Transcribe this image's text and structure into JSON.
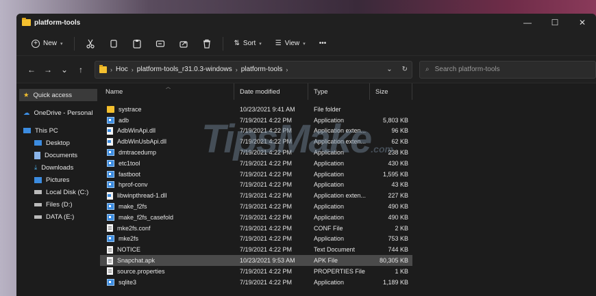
{
  "window": {
    "title": "platform-tools"
  },
  "window_controls": {
    "minimize": "—",
    "maximize": "☐",
    "close": "✕"
  },
  "toolbar": {
    "new_label": "New",
    "sort_label": "Sort",
    "view_label": "View",
    "more_label": "•••"
  },
  "address": {
    "crumbs": [
      "Hoc",
      "platform-tools_r31.0.3-windows",
      "platform-tools"
    ]
  },
  "search": {
    "placeholder": "Search platform-tools"
  },
  "sidebar": {
    "items": [
      {
        "label": "Quick access",
        "icon": "star-icon"
      },
      {
        "label": "OneDrive - Personal",
        "icon": "cloud-icon"
      },
      {
        "label": "This PC",
        "icon": "monitor-icon"
      },
      {
        "label": "Desktop",
        "icon": "desktop-icon"
      },
      {
        "label": "Documents",
        "icon": "documents-icon"
      },
      {
        "label": "Downloads",
        "icon": "download-icon"
      },
      {
        "label": "Pictures",
        "icon": "pictures-icon"
      },
      {
        "label": "Local Disk (C:)",
        "icon": "drive-icon"
      },
      {
        "label": "Files (D:)",
        "icon": "drive-icon"
      },
      {
        "label": "DATA (E:)",
        "icon": "drive-icon"
      }
    ]
  },
  "columns": {
    "name": "Name",
    "date": "Date modified",
    "type": "Type",
    "size": "Size"
  },
  "files": [
    {
      "name": "systrace",
      "date": "10/23/2021 9:41 AM",
      "type": "File folder",
      "size": "",
      "icon": "folder"
    },
    {
      "name": "adb",
      "date": "7/19/2021 4:22 PM",
      "type": "Application",
      "size": "5,803 KB",
      "icon": "app"
    },
    {
      "name": "AdbWinApi.dll",
      "date": "7/19/2021 4:22 PM",
      "type": "Application exten...",
      "size": "96 KB",
      "icon": "dll"
    },
    {
      "name": "AdbWinUsbApi.dll",
      "date": "7/19/2021 4:22 PM",
      "type": "Application exten...",
      "size": "62 KB",
      "icon": "dll"
    },
    {
      "name": "dmtracedump",
      "date": "7/19/2021 4:22 PM",
      "type": "Application",
      "size": "238 KB",
      "icon": "app"
    },
    {
      "name": "etc1tool",
      "date": "7/19/2021 4:22 PM",
      "type": "Application",
      "size": "430 KB",
      "icon": "app"
    },
    {
      "name": "fastboot",
      "date": "7/19/2021 4:22 PM",
      "type": "Application",
      "size": "1,595 KB",
      "icon": "app"
    },
    {
      "name": "hprof-conv",
      "date": "7/19/2021 4:22 PM",
      "type": "Application",
      "size": "43 KB",
      "icon": "app"
    },
    {
      "name": "libwinpthread-1.dll",
      "date": "7/19/2021 4:22 PM",
      "type": "Application exten...",
      "size": "227 KB",
      "icon": "dll"
    },
    {
      "name": "make_f2fs",
      "date": "7/19/2021 4:22 PM",
      "type": "Application",
      "size": "490 KB",
      "icon": "app"
    },
    {
      "name": "make_f2fs_casefold",
      "date": "7/19/2021 4:22 PM",
      "type": "Application",
      "size": "490 KB",
      "icon": "app"
    },
    {
      "name": "mke2fs.conf",
      "date": "7/19/2021 4:22 PM",
      "type": "CONF File",
      "size": "2 KB",
      "icon": "doc"
    },
    {
      "name": "mke2fs",
      "date": "7/19/2021 4:22 PM",
      "type": "Application",
      "size": "753 KB",
      "icon": "app"
    },
    {
      "name": "NOTICE",
      "date": "7/19/2021 4:22 PM",
      "type": "Text Document",
      "size": "744 KB",
      "icon": "doc"
    },
    {
      "name": "Snapchat.apk",
      "date": "10/23/2021 9:53 AM",
      "type": "APK File",
      "size": "80,305 KB",
      "icon": "doc",
      "selected": true
    },
    {
      "name": "source.properties",
      "date": "7/19/2021 4:22 PM",
      "type": "PROPERTIES File",
      "size": "1 KB",
      "icon": "doc"
    },
    {
      "name": "sqlite3",
      "date": "7/19/2021 4:22 PM",
      "type": "Application",
      "size": "1,189 KB",
      "icon": "app"
    }
  ],
  "watermark": {
    "main": "TipsMake",
    "suffix": ".com"
  }
}
